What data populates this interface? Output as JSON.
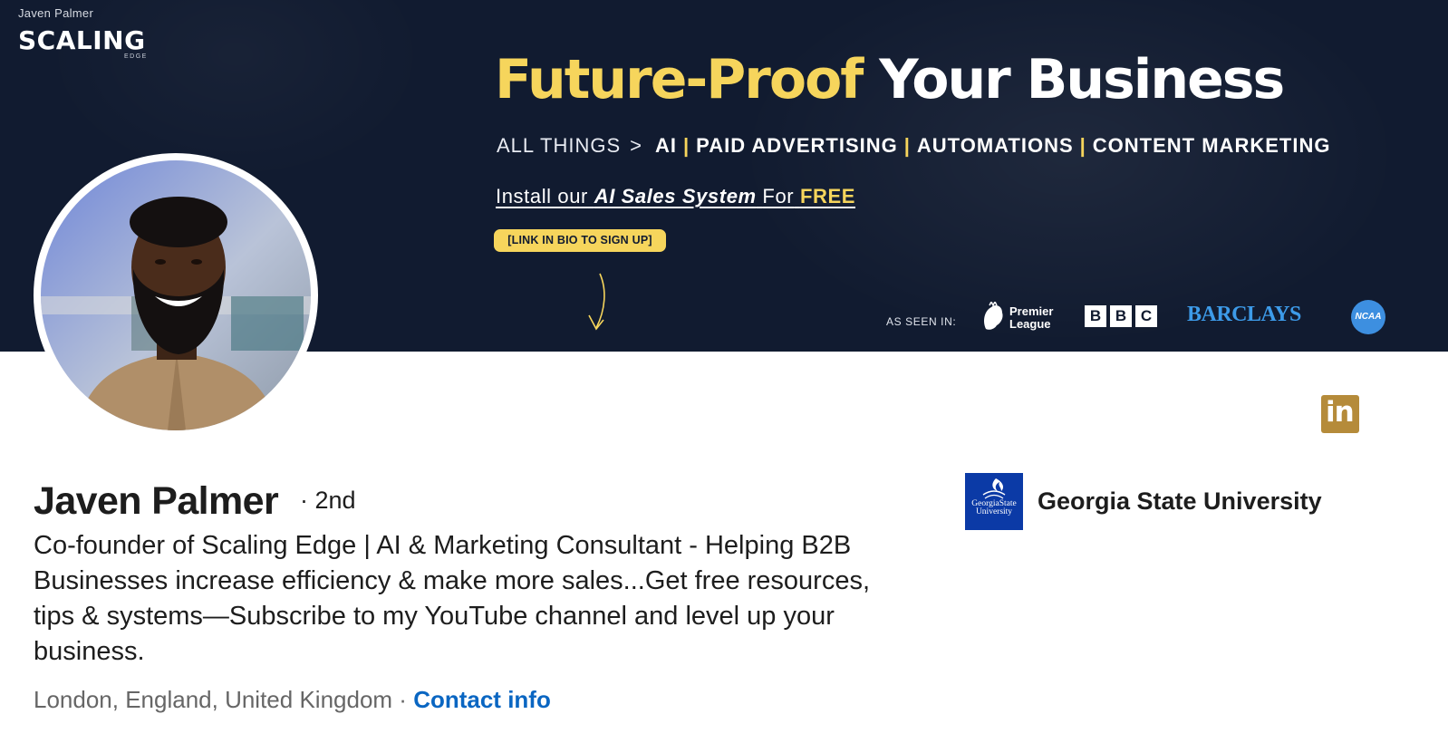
{
  "banner": {
    "owner_name": "Javen Palmer",
    "brand": {
      "word": "SCALING",
      "sub": "EDGE"
    },
    "headline": {
      "part1": "Future-Proof",
      "part2": "Your Business"
    },
    "topics": {
      "prefix": "ALL THINGS",
      "chevron": ">",
      "items": [
        "AI",
        "PAID ADVERTISING",
        "AUTOMATIONS",
        "CONTENT MARKETING"
      ],
      "separator": "|"
    },
    "install": {
      "pre": "Install our",
      "ai_system": "AI Sales System",
      "mid": "For",
      "free": "FREE"
    },
    "cta_pill": "[LINK IN BIO TO SIGN UP]",
    "as_seen_in": "AS SEEN IN:",
    "press_logos": {
      "premier_league": "Premier League",
      "bbc": [
        "B",
        "B",
        "C"
      ],
      "barclays": "BARCLAYS",
      "ncaa": "NCAA"
    },
    "colors": {
      "background": "#111b30",
      "accent_yellow": "#f6d55c",
      "barclays_blue": "#3d9be9"
    }
  },
  "profile": {
    "name": "Javen Palmer",
    "degree": "· 2nd",
    "headline": "Co-founder of Scaling Edge | AI & Marketing Consultant - Helping B2B Businesses increase efficiency & make more sales...Get free resources, tips & systems—Subscribe to my YouTube channel and level up your business.",
    "location": "London, England, United Kingdom",
    "location_sep": " · ",
    "contact_info": "Contact info",
    "linkedin_icon": "in"
  },
  "education": {
    "school": "Georgia State University",
    "logo_text": "GeorgiaState University"
  },
  "theme": {
    "link_blue": "#0a66c2",
    "muted_text": "#666666",
    "linkedin_gold": "#b58b3a"
  }
}
